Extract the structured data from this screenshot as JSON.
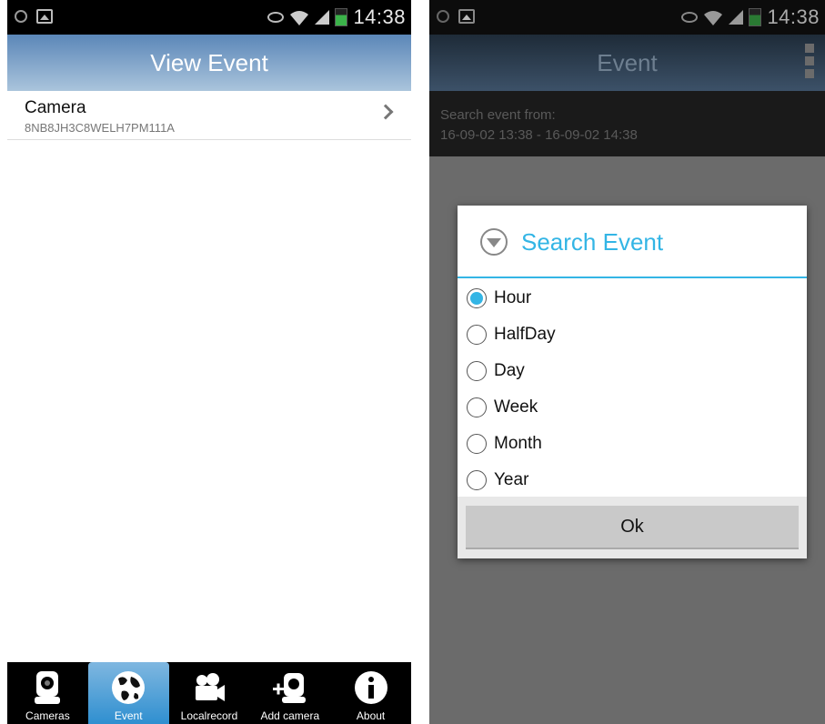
{
  "status_bar": {
    "time": "14:38"
  },
  "left": {
    "title": "View Event",
    "camera": {
      "name": "Camera",
      "id": "8NB8JH3C8WELH7PM111A"
    },
    "bottom_nav": [
      {
        "label": "Cameras",
        "icon": "camera-icon"
      },
      {
        "label": "Event",
        "icon": "globe-icon"
      },
      {
        "label": "Localrecord",
        "icon": "video-record-icon"
      },
      {
        "label": "Add camera",
        "icon": "add-camera-icon"
      },
      {
        "label": "About",
        "icon": "info-icon"
      }
    ],
    "active_nav": "Event"
  },
  "right": {
    "title": "Event",
    "search_from_label": "Search event from:",
    "search_range": "16-09-02 13:38 - 16-09-02 14:38",
    "dialog": {
      "title": "Search Event",
      "options": [
        "Hour",
        "HalfDay",
        "Day",
        "Week",
        "Month",
        "Year"
      ],
      "selected": "Hour",
      "ok_label": "Ok"
    }
  },
  "colors": {
    "accent": "#33b5e5",
    "nav_active": "#2f8fd0"
  }
}
